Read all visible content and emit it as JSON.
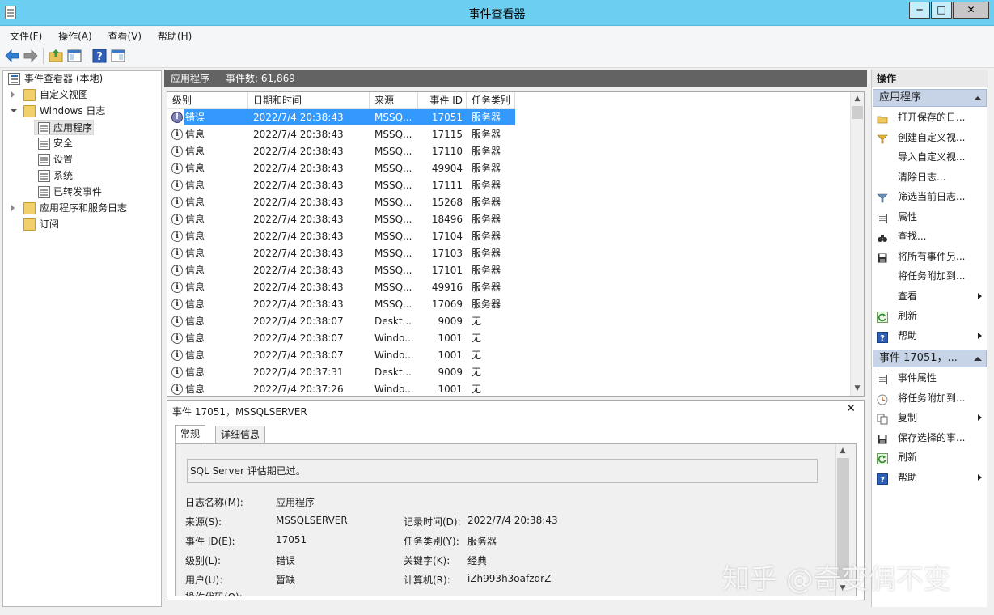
{
  "window": {
    "title": "事件查看器"
  },
  "menu": [
    "文件(F)",
    "操作(A)",
    "查看(V)",
    "帮助(H)"
  ],
  "tree": {
    "root": "事件查看器 (本地)",
    "custom_views": "自定义视图",
    "windows_logs": "Windows 日志",
    "application": "应用程序",
    "security": "安全",
    "setup": "设置",
    "system": "系统",
    "forwarded": "已转发事件",
    "app_service_logs": "应用程序和服务日志",
    "subscriptions": "订阅"
  },
  "center": {
    "log_name": "应用程序",
    "event_count": "事件数: 61,869"
  },
  "grid": {
    "columns": [
      "级别",
      "日期和时间",
      "来源",
      "事件 ID",
      "任务类别"
    ],
    "rows": [
      {
        "level": "错误",
        "type": "error",
        "datetime": "2022/7/4 20:38:43",
        "source": "MSSQ...",
        "id": "17051",
        "category": "服务器"
      },
      {
        "level": "信息",
        "type": "info",
        "datetime": "2022/7/4 20:38:43",
        "source": "MSSQ...",
        "id": "17115",
        "category": "服务器"
      },
      {
        "level": "信息",
        "type": "info",
        "datetime": "2022/7/4 20:38:43",
        "source": "MSSQ...",
        "id": "17110",
        "category": "服务器"
      },
      {
        "level": "信息",
        "type": "info",
        "datetime": "2022/7/4 20:38:43",
        "source": "MSSQ...",
        "id": "49904",
        "category": "服务器"
      },
      {
        "level": "信息",
        "type": "info",
        "datetime": "2022/7/4 20:38:43",
        "source": "MSSQ...",
        "id": "17111",
        "category": "服务器"
      },
      {
        "level": "信息",
        "type": "info",
        "datetime": "2022/7/4 20:38:43",
        "source": "MSSQ...",
        "id": "15268",
        "category": "服务器"
      },
      {
        "level": "信息",
        "type": "info",
        "datetime": "2022/7/4 20:38:43",
        "source": "MSSQ...",
        "id": "18496",
        "category": "服务器"
      },
      {
        "level": "信息",
        "type": "info",
        "datetime": "2022/7/4 20:38:43",
        "source": "MSSQ...",
        "id": "17104",
        "category": "服务器"
      },
      {
        "level": "信息",
        "type": "info",
        "datetime": "2022/7/4 20:38:43",
        "source": "MSSQ...",
        "id": "17103",
        "category": "服务器"
      },
      {
        "level": "信息",
        "type": "info",
        "datetime": "2022/7/4 20:38:43",
        "source": "MSSQ...",
        "id": "17101",
        "category": "服务器"
      },
      {
        "level": "信息",
        "type": "info",
        "datetime": "2022/7/4 20:38:43",
        "source": "MSSQ...",
        "id": "49916",
        "category": "服务器"
      },
      {
        "level": "信息",
        "type": "info",
        "datetime": "2022/7/4 20:38:43",
        "source": "MSSQ...",
        "id": "17069",
        "category": "服务器"
      },
      {
        "level": "信息",
        "type": "info",
        "datetime": "2022/7/4 20:38:07",
        "source": "Deskt...",
        "id": "9009",
        "category": "无"
      },
      {
        "level": "信息",
        "type": "info",
        "datetime": "2022/7/4 20:38:07",
        "source": "Windo...",
        "id": "1001",
        "category": "无"
      },
      {
        "level": "信息",
        "type": "info",
        "datetime": "2022/7/4 20:38:07",
        "source": "Windo...",
        "id": "1001",
        "category": "无"
      },
      {
        "level": "信息",
        "type": "info",
        "datetime": "2022/7/4 20:37:31",
        "source": "Deskt...",
        "id": "9009",
        "category": "无"
      },
      {
        "level": "信息",
        "type": "info",
        "datetime": "2022/7/4 20:37:26",
        "source": "Windo...",
        "id": "1001",
        "category": "无"
      }
    ]
  },
  "detail": {
    "header": "事件 17051，MSSQLSERVER",
    "tabs": [
      "常规",
      "详细信息"
    ],
    "message": "SQL Server 评估期已过。",
    "fields": {
      "log_name_label": "日志名称(M):",
      "log_name": "应用程序",
      "source_label": "来源(S):",
      "source": "MSSQLSERVER",
      "logged_label": "记录时间(D):",
      "logged": "2022/7/4 20:38:43",
      "event_id_label": "事件 ID(E):",
      "event_id": "17051",
      "task_label": "任务类别(Y):",
      "task": "服务器",
      "level_label": "级别(L):",
      "level": "错误",
      "keywords_label": "关键字(K):",
      "keywords": "经典",
      "user_label": "用户(U):",
      "user": "暂缺",
      "computer_label": "计算机(R):",
      "computer": "iZh993h3oafzdrZ",
      "opcode_label": "操作代码(O):"
    }
  },
  "actions": {
    "title": "操作",
    "section1": "应用程序",
    "items1": [
      {
        "label": "打开保存的日...",
        "icon": "open-folder-icon",
        "submenu": false
      },
      {
        "label": "创建自定义视...",
        "icon": "filter-create-icon",
        "submenu": false
      },
      {
        "label": "导入自定义视...",
        "icon": "",
        "submenu": false
      },
      {
        "label": "清除日志...",
        "icon": "",
        "submenu": false
      },
      {
        "label": "筛选当前日志...",
        "icon": "filter-icon",
        "submenu": false
      },
      {
        "label": "属性",
        "icon": "properties-icon",
        "submenu": false
      },
      {
        "label": "查找...",
        "icon": "binoculars-icon",
        "submenu": false
      },
      {
        "label": "将所有事件另...",
        "icon": "save-icon",
        "submenu": false
      },
      {
        "label": "将任务附加到...",
        "icon": "",
        "submenu": false
      },
      {
        "label": "查看",
        "icon": "",
        "submenu": true
      },
      {
        "label": "刷新",
        "icon": "refresh-icon",
        "submenu": false
      },
      {
        "label": "帮助",
        "icon": "help-icon",
        "submenu": true
      }
    ],
    "section2": "事件 17051，...",
    "items2": [
      {
        "label": "事件属性",
        "icon": "properties-icon",
        "submenu": false
      },
      {
        "label": "将任务附加到...",
        "icon": "task-icon",
        "submenu": false
      },
      {
        "label": "复制",
        "icon": "copy-icon",
        "submenu": true
      },
      {
        "label": "保存选择的事...",
        "icon": "save-icon",
        "submenu": false
      },
      {
        "label": "刷新",
        "icon": "refresh-icon",
        "submenu": false
      },
      {
        "label": "帮助",
        "icon": "help-icon",
        "submenu": true
      }
    ]
  },
  "watermark": "知乎 @奇变偶不变"
}
